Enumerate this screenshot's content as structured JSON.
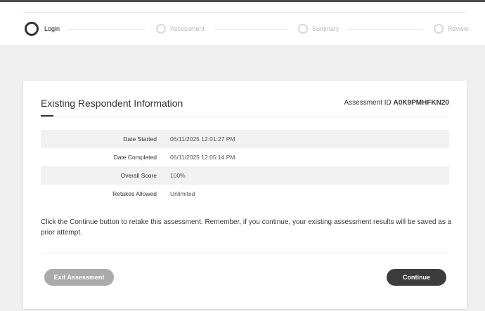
{
  "header": {
    "top_fragment": "·",
    "steps": [
      {
        "label": "Login",
        "active": true
      },
      {
        "label": "Assessment",
        "active": false
      },
      {
        "label": "Summary",
        "active": false
      },
      {
        "label": "Review",
        "active": false
      }
    ]
  },
  "card": {
    "title": "Existing Respondent Information",
    "assessment_id_label": "Assessment ID",
    "assessment_id_value": "A0K9PMHFKN20",
    "rows": [
      {
        "label": "Date Started",
        "value": "06/11/2025 12:01:27 PM"
      },
      {
        "label": "Date Completed",
        "value": "06/11/2025 12:05:14 PM"
      },
      {
        "label": "Overall Score",
        "value": "100%"
      },
      {
        "label": "Retakes Allowed",
        "value": "Unlimited"
      }
    ],
    "message": "Click the Continue button to retake this assessment. Remember, if you continue, your existing assessment results will be saved as a prior attempt.",
    "exit_button": "Exit Assessment",
    "continue_button": "Continue"
  },
  "colors": {
    "page_background": "#f0f0f0",
    "active_step": "#333333",
    "inactive_step": "#d8d8d8",
    "exit_button": "#aaaaaa",
    "continue_button": "#3c3c3c"
  }
}
